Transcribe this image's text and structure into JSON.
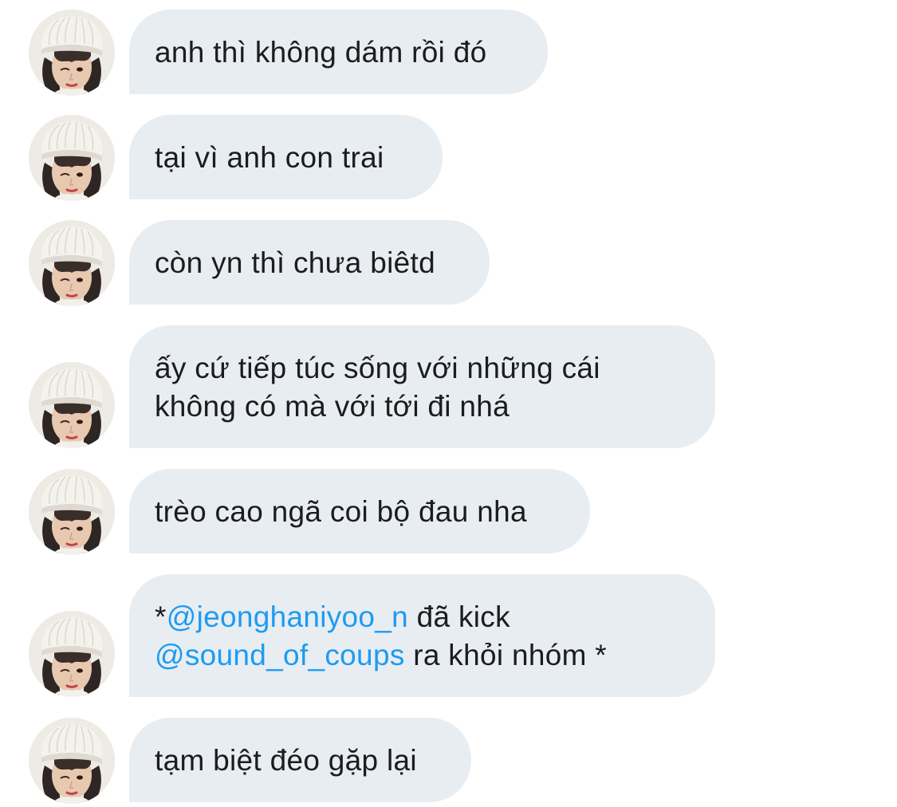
{
  "colors": {
    "bubble": "#e8edf2",
    "text": "#1c1c1e",
    "mention": "#1d9bf0"
  },
  "avatar": {
    "icon": "profile-photo-beanie"
  },
  "messages": [
    {
      "text": "anh thì không dám rồi đó"
    },
    {
      "text": "tại vì anh con trai"
    },
    {
      "text": "còn yn thì chưa biêtd"
    },
    {
      "line1": "ấy cứ tiếp túc sống với những cái",
      "line2": "không có mà với tới đi nhá"
    },
    {
      "text": "trèo cao ngã coi bộ đau nha"
    },
    {
      "prefix": "*",
      "mention1": "@jeonghaniyoo_n",
      "middle": " đã kick",
      "mention2": "@sound_of_coups",
      "suffix": " ra khỏi nhóm *"
    },
    {
      "text": "tạm biệt đéo gặp lại"
    }
  ]
}
